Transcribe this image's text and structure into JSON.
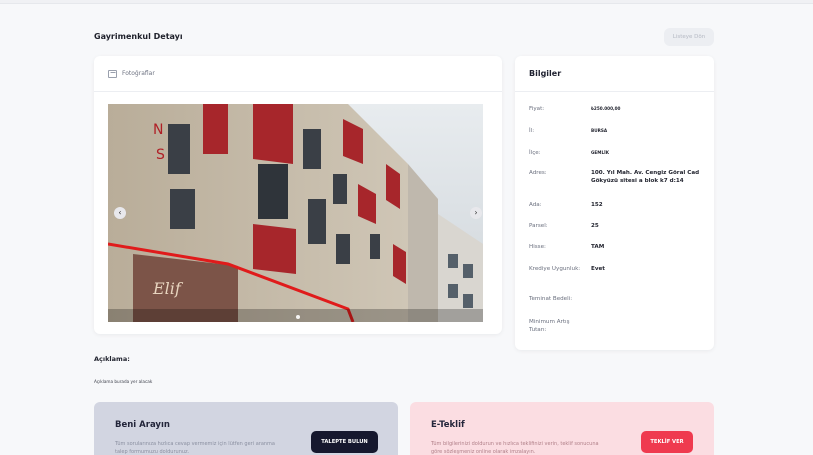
{
  "header": {
    "title": "Gayrimenkul Detayı",
    "back_label": "Listeye Dön"
  },
  "photos": {
    "label": "Fotoğraflar",
    "icon": "image-icon",
    "prev_icon": "chevron-left-icon",
    "next_icon": "chevron-right-icon"
  },
  "info": {
    "title": "Bilgiler",
    "rows": [
      {
        "key": "Fiyat:",
        "value": "₺250.000,00"
      },
      {
        "key": "İl:",
        "value": "BURSA"
      },
      {
        "key": "İlçe:",
        "value": "GEMLİK"
      },
      {
        "key": "Adres:",
        "value": "100. Yıl Mah. Av. Cengiz Göral Cad Gökyüzü sitesi a blok k7 d:14"
      },
      {
        "key": "Ada:",
        "value": "152"
      },
      {
        "key": "Parsel:",
        "value": "25"
      },
      {
        "key": "Hisse:",
        "value": "TAM"
      },
      {
        "key": "Krediye Uygunluk:",
        "value": "Evet"
      },
      {
        "key": "Teminat Bedeli:",
        "value": ""
      },
      {
        "key": "Minimum Artış Tutarı:",
        "value": ""
      }
    ]
  },
  "description": {
    "label": "Açıklama:",
    "text": "Açıklama burada yer alacak"
  },
  "cta_call": {
    "title": "Beni Arayın",
    "desc": "Tüm sorularınıza hızlıca cevap vermemiz için lütfen geri aranma talep formumuzu doldurunuz.",
    "button": "TALEPTE BULUN"
  },
  "cta_offer": {
    "title": "E-Teklif",
    "desc": "Tüm bilgilerinizi doldurun ve hızlıca teklifinizi verin, teklif sonucuna göre sözleşmeniz online olarak imzalayın.",
    "button": "TEKLİF VER"
  },
  "colors": {
    "primary_dark": "#16182e",
    "accent_red": "#ef3a4f"
  }
}
